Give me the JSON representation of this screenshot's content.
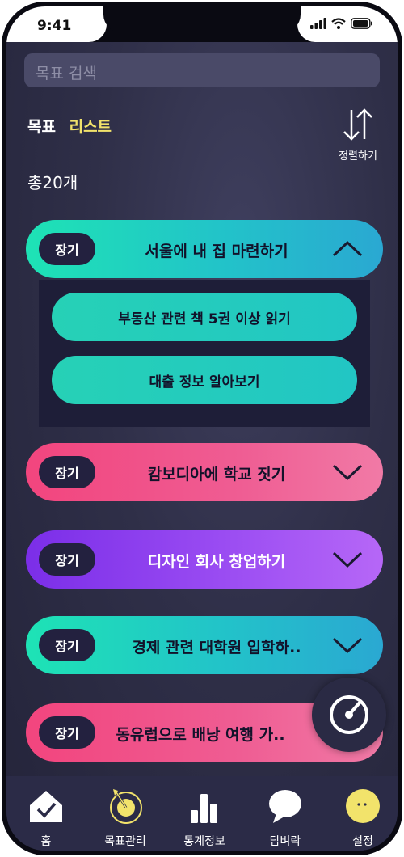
{
  "status": {
    "time": "9:41"
  },
  "search": {
    "placeholder": "목표 검색"
  },
  "header": {
    "tab_goal": "목표",
    "tab_list": "리스트",
    "sort_label": "정렬하기",
    "count": "총20개"
  },
  "goals": [
    {
      "badge": "장기",
      "title": "서울에 내 집 마련하기",
      "color": "#1ee3b5",
      "expanded": true,
      "subgoals": [
        "부동산 관련 책 5권 이상 읽기",
        "대출 정보 알아보기"
      ]
    },
    {
      "badge": "장기",
      "title": "캄보디아에 학교 짓기",
      "color": "#f2457e",
      "expanded": false
    },
    {
      "badge": "장기",
      "title": "디자인 회사 창업하기",
      "color": "#8b3cee",
      "expanded": false
    },
    {
      "badge": "장기",
      "title": "경제 관련 대학원 입학하..",
      "color": "#1ee3b5",
      "expanded": false
    },
    {
      "badge": "장기",
      "title": "동유럽으로 배낭 여행 가..",
      "color": "#f2457e",
      "expanded": false
    }
  ],
  "tabbar": [
    {
      "label": "홈",
      "icon": "home-check-icon"
    },
    {
      "label": "목표관리",
      "icon": "target-icon",
      "active": true
    },
    {
      "label": "통계정보",
      "icon": "bar-chart-icon"
    },
    {
      "label": "담벼락",
      "icon": "speech-bubble-icon"
    },
    {
      "label": "설정",
      "icon": "smiley-icon"
    }
  ]
}
